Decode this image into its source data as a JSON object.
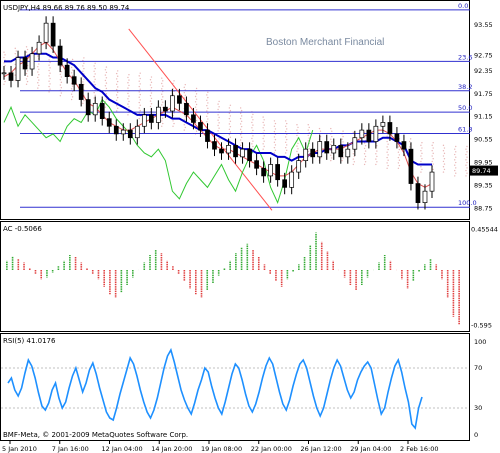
{
  "chart_data": [
    {
      "type": "candlestick",
      "panel": "price",
      "header": "USDJPY,H4  89.66 89.76 89.50 89.74",
      "watermark": "Boston Merchant Financial",
      "ylim": [
        88.55,
        94.05
      ],
      "y_ticks": [
        "93.55",
        "92.75",
        "92.35",
        "91.75",
        "91.15",
        "90.55",
        "89.95",
        "89.35",
        "88.75"
      ],
      "current_price": "89.74",
      "fibonacci": [
        {
          "label": "0.0",
          "price": 93.95
        },
        {
          "label": "23.6",
          "price": 92.6
        },
        {
          "label": "38.2",
          "price": 91.83
        },
        {
          "label": "50.0",
          "price": 91.27
        },
        {
          "label": "61.8",
          "price": 90.71
        },
        {
          "label": "100.0",
          "price": 88.78
        }
      ],
      "trendline": {
        "from": [
          0.27,
          93.45
        ],
        "to": [
          0.58,
          88.7
        ]
      },
      "close": [
        92.3,
        92.1,
        92.7,
        92.4,
        92.8,
        93.1,
        93.6,
        93.0,
        92.5,
        92.2,
        92.0,
        91.6,
        91.2,
        91.5,
        91.1,
        90.9,
        90.7,
        90.8,
        90.6,
        90.9,
        91.2,
        91.0,
        91.4,
        91.3,
        91.7,
        91.5,
        91.2,
        91.0,
        90.8,
        90.5,
        90.3,
        90.2,
        90.4,
        90.1,
        90.3,
        90.0,
        89.8,
        89.6,
        89.9,
        89.5,
        89.3,
        89.7,
        90.0,
        90.3,
        90.1,
        90.5,
        90.2,
        90.4,
        90.1,
        90.3,
        90.6,
        90.8,
        90.5,
        90.9,
        91.0,
        90.7,
        90.5,
        90.3,
        89.4,
        88.9,
        89.2,
        89.7
      ],
      "ichimoku_span_top": [
        92.9,
        93.0,
        93.0,
        92.9,
        92.8,
        92.8,
        92.7,
        92.7,
        92.6,
        92.5,
        92.4,
        92.3,
        92.3,
        92.2,
        92.2,
        92.1,
        92.0,
        91.9,
        91.8,
        91.6,
        91.5,
        91.4,
        91.3,
        91.2,
        91.1,
        91.1,
        91.0,
        91.0,
        90.9,
        90.9,
        90.8,
        90.8,
        90.8,
        90.7,
        90.7,
        90.6,
        90.6,
        90.5,
        90.5,
        90.4,
        90.4,
        90.4
      ],
      "ichimoku_span_bottom": [
        92.0,
        92.1,
        92.0,
        91.9,
        91.8,
        91.7,
        91.6,
        91.5,
        91.5,
        91.4,
        91.3,
        91.2,
        91.1,
        91.0,
        90.9,
        90.9,
        90.8,
        90.7,
        90.6,
        90.5,
        90.4,
        90.4,
        90.3,
        90.3,
        90.2,
        90.2,
        90.1,
        90.1,
        90.0,
        90.0,
        90.0,
        89.9,
        89.9,
        89.9,
        89.8,
        89.8,
        89.8,
        89.7,
        89.7,
        89.7,
        89.6,
        89.6
      ],
      "kijun_sen": [
        92.6,
        92.6,
        92.7,
        92.7,
        92.8,
        92.8,
        92.8,
        92.7,
        92.7,
        92.6,
        92.5,
        92.3,
        92.1,
        91.9,
        91.8,
        91.6,
        91.5,
        91.4,
        91.3,
        91.2,
        91.2,
        91.2,
        91.2,
        91.2,
        91.1,
        91.1,
        91.0,
        90.9,
        90.8,
        90.8,
        90.7,
        90.6,
        90.5,
        90.4,
        90.3,
        90.3,
        90.2,
        90.2,
        90.2,
        90.1,
        90.1,
        90.0,
        90.1,
        90.1,
        90.2,
        90.2,
        90.3,
        90.3,
        90.4,
        90.4,
        90.5,
        90.5,
        90.5,
        90.5,
        90.6,
        90.6,
        90.5,
        90.4,
        90.0,
        89.9,
        89.9,
        89.9
      ],
      "tenkan_sen": [
        92.2,
        92.3,
        92.5,
        92.6,
        92.8,
        93.0,
        93.1,
        92.9,
        92.6,
        92.3,
        92.1,
        91.8,
        91.5,
        91.4,
        91.2,
        91.0,
        90.9,
        90.8,
        90.8,
        90.9,
        91.0,
        91.1,
        91.2,
        91.3,
        91.4,
        91.3,
        91.2,
        91.0,
        90.8,
        90.6,
        90.4,
        90.3,
        90.3,
        90.2,
        90.1,
        90.0,
        89.9,
        89.8,
        89.7,
        89.6,
        89.6,
        89.7,
        89.9,
        90.1,
        90.2,
        90.3,
        90.3,
        90.3,
        90.3,
        90.4,
        90.5,
        90.6,
        90.7,
        90.8,
        90.8,
        90.7,
        90.5,
        90.2,
        89.7,
        89.4,
        89.3,
        89.4
      ],
      "chikou_span": [
        91.0,
        91.4,
        90.9,
        91.2,
        91.0,
        90.8,
        90.6,
        90.7,
        90.5,
        90.9,
        91.1,
        91.0,
        91.3,
        91.2,
        91.6,
        91.4,
        91.1,
        90.9,
        90.7,
        90.4,
        90.2,
        90.1,
        90.3,
        90.0,
        89.2,
        89.0,
        89.4,
        89.7,
        89.5,
        89.3,
        89.6,
        89.9,
        89.5,
        89.2,
        89.7,
        90.1,
        90.4,
        90.0,
        89.3,
        88.9,
        89.5,
        90.3,
        90.6,
        90.2,
        90.8
      ]
    },
    {
      "type": "bar",
      "panel": "oscillator",
      "title": "AC -0.5066",
      "y_ticks": [
        "0.45544",
        "-0.595"
      ],
      "ylim": [
        -0.62,
        0.47
      ],
      "values": [
        0.1,
        0.15,
        0.12,
        0.08,
        0.02,
        -0.05,
        -0.1,
        -0.08,
        -0.03,
        0.04,
        0.1,
        0.16,
        0.14,
        0.08,
        0.02,
        -0.04,
        -0.1,
        -0.18,
        -0.26,
        -0.3,
        -0.24,
        -0.16,
        -0.08,
        0.0,
        0.08,
        0.16,
        0.22,
        0.18,
        0.1,
        0.04,
        -0.04,
        -0.12,
        -0.2,
        -0.26,
        -0.3,
        -0.22,
        -0.14,
        -0.06,
        0.02,
        0.1,
        0.18,
        0.24,
        0.28,
        0.22,
        0.14,
        0.06,
        -0.04,
        -0.12,
        -0.18,
        -0.1,
        -0.02,
        0.06,
        0.14,
        0.26,
        0.4,
        0.3,
        0.2,
        0.1,
        0.0,
        -0.08,
        -0.16,
        -0.22,
        -0.16,
        -0.08,
        0.0,
        0.08,
        0.16,
        0.1,
        0.0,
        -0.1,
        -0.2,
        -0.12,
        -0.02,
        0.06,
        0.12,
        0.06,
        -0.1,
        -0.3,
        -0.5,
        -0.58
      ]
    },
    {
      "type": "line",
      "panel": "oscillator",
      "title": "RSI(5) 41.0176",
      "ylim": [
        0,
        100
      ],
      "y_ticks": [
        "100",
        "70",
        "30",
        "0"
      ],
      "levels": [
        70,
        30
      ],
      "values": [
        55,
        60,
        48,
        42,
        50,
        65,
        78,
        72,
        60,
        45,
        32,
        28,
        35,
        48,
        55,
        40,
        30,
        36,
        50,
        62,
        70,
        58,
        46,
        55,
        68,
        75,
        64,
        50,
        38,
        26,
        20,
        18,
        30,
        44,
        56,
        68,
        80,
        74,
        62,
        48,
        36,
        26,
        20,
        28,
        40,
        55,
        70,
        82,
        88,
        76,
        62,
        48,
        38,
        30,
        24,
        35,
        48,
        58,
        70,
        66,
        52,
        40,
        30,
        24,
        36,
        50,
        64,
        74,
        70,
        58,
        44,
        32,
        26,
        34,
        46,
        60,
        72,
        80,
        74,
        60,
        46,
        34,
        28,
        38,
        52,
        64,
        74,
        78,
        70,
        56,
        42,
        30,
        22,
        30,
        44,
        58,
        70,
        78,
        72,
        60,
        48,
        40,
        46,
        58,
        66,
        72,
        76,
        70,
        54,
        38,
        24,
        30,
        46,
        60,
        72,
        78,
        66,
        50,
        36,
        14,
        10,
        30,
        41
      ]
    },
    {
      "type": "axis",
      "panel": "time",
      "x_ticks": [
        "5 Jan 2010",
        "7 Jan 16:00",
        "12 Jan 04:00",
        "14 Jan 20:00",
        "19 Jan 08:00",
        "22 Jan 00:00",
        "26 Jan 12:00",
        "29 Jan 04:00",
        "2 Feb 16:00"
      ],
      "copyright": "BMF-Meta, © 2001-2009 MetaQuotes Software Corp."
    }
  ],
  "colors": {
    "background": "#ffffff",
    "grid": "#c0c0c0",
    "candle": "#000000",
    "kijun": "#0000c8",
    "tenkan": "#e05050",
    "chikou": "#32c832",
    "cloud": "#e8b8b8",
    "fibo": "#3030d0",
    "trendline": "#ff5050",
    "ac_up": "#33aa33",
    "ac_down": "#e04040",
    "rsi": "#1e90ff"
  }
}
